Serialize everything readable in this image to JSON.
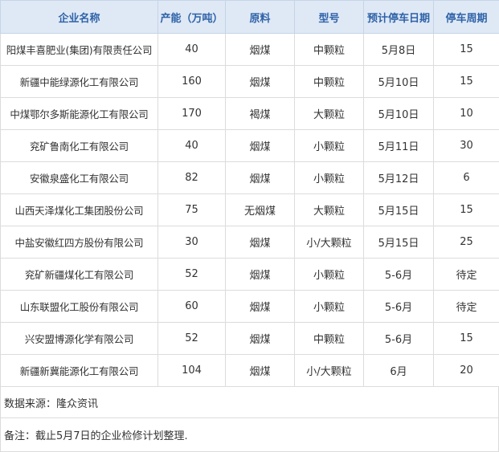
{
  "table": {
    "headers": [
      "企业名称",
      "产能（万吨）",
      "原料",
      "型号",
      "预计停车日期",
      "停车周期"
    ],
    "rows": [
      [
        "阳煤丰喜肥业(集团)有限责任公司",
        "40",
        "烟煤",
        "中颗粒",
        "5月8日",
        "15"
      ],
      [
        "新疆中能绿源化工有限公司",
        "160",
        "烟煤",
        "中颗粒",
        "5月10日",
        "15"
      ],
      [
        "中煤鄂尔多斯能源化工有限公司",
        "170",
        "褐煤",
        "大颗粒",
        "5月10日",
        "10"
      ],
      [
        "兖矿鲁南化工有限公司",
        "40",
        "烟煤",
        "小颗粒",
        "5月11日",
        "30"
      ],
      [
        "安徽泉盛化工有限公司",
        "82",
        "烟煤",
        "小颗粒",
        "5月12日",
        "6"
      ],
      [
        "山西天泽煤化工集团股份公司",
        "75",
        "无烟煤",
        "大颗粒",
        "5月15日",
        "15"
      ],
      [
        "中盐安徽红四方股份有限公司",
        "30",
        "烟煤",
        "小/大颗粒",
        "5月15日",
        "25"
      ],
      [
        "兖矿新疆煤化工有限公司",
        "52",
        "烟煤",
        "小颗粒",
        "5-6月",
        "待定"
      ],
      [
        "山东联盟化工股份有限公司",
        "60",
        "烟煤",
        "小颗粒",
        "5-6月",
        "待定"
      ],
      [
        "兴安盟博源化学有限公司",
        "52",
        "烟煤",
        "中颗粒",
        "5-6月",
        "15"
      ],
      [
        "新疆新冀能源化工有限公司",
        "104",
        "烟煤",
        "小/大颗粒",
        "6月",
        "20"
      ]
    ]
  },
  "notes": {
    "source": "数据来源：隆众资讯",
    "remark": "备注：截止5月7日的企业检修计划整理."
  },
  "colors": {
    "header_bg": "#dfe9f6",
    "header_text": "#2f62a8",
    "cell_text": "#333333",
    "border": "#dcdcdc"
  }
}
